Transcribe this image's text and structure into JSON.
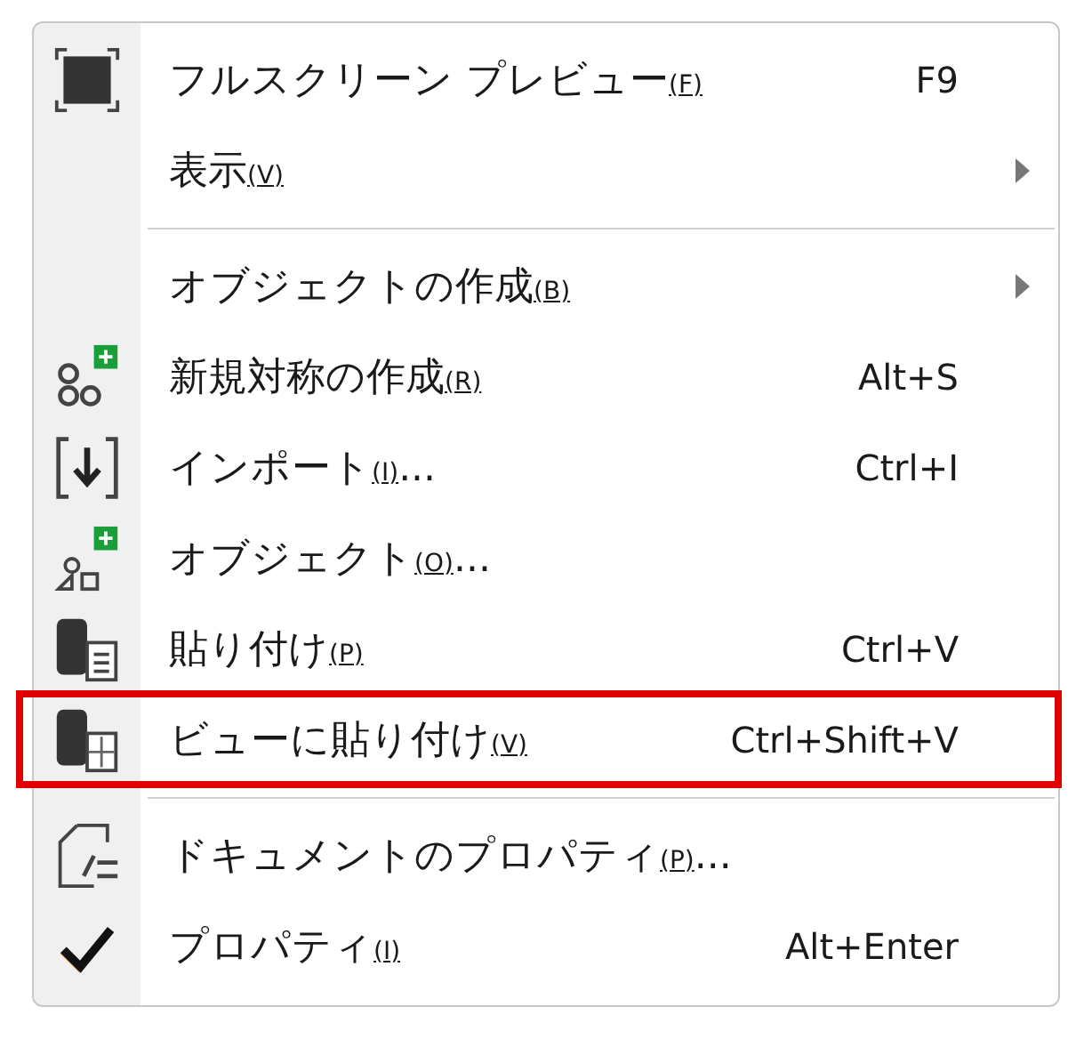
{
  "menu": {
    "items": [
      {
        "kind": "item",
        "label": "フルスクリーン プレビュー",
        "mnemonic": "(F)",
        "shortcut": "F9",
        "submenu": false,
        "highlighted": false,
        "checked": false
      },
      {
        "kind": "item",
        "label": "表示",
        "mnemonic": "(V)",
        "submenu": true,
        "highlighted": false,
        "checked": false
      },
      {
        "kind": "separator"
      },
      {
        "kind": "item",
        "label": "オブジェクトの作成",
        "mnemonic": "(B)",
        "submenu": true,
        "highlighted": false,
        "checked": false
      },
      {
        "kind": "item",
        "label": "新規対称の作成",
        "mnemonic": "(R)",
        "shortcut": "Alt+S",
        "submenu": false,
        "highlighted": false,
        "checked": false
      },
      {
        "kind": "item",
        "label": "インポート",
        "mnemonic": "(I)",
        "ellipsis": "...",
        "shortcut": "Ctrl+I",
        "submenu": false,
        "highlighted": false,
        "checked": false
      },
      {
        "kind": "item",
        "label": "オブジェクト",
        "mnemonic": "(O)",
        "ellipsis": "...",
        "submenu": false,
        "highlighted": false,
        "checked": false
      },
      {
        "kind": "item",
        "label": "貼り付け",
        "mnemonic": "(P)",
        "shortcut": "Ctrl+V",
        "submenu": false,
        "highlighted": false,
        "checked": false
      },
      {
        "kind": "item",
        "label": "ビューに貼り付け",
        "mnemonic": "(V)",
        "shortcut": "Ctrl+Shift+V",
        "submenu": false,
        "highlighted": true,
        "checked": false
      },
      {
        "kind": "separator"
      },
      {
        "kind": "item",
        "label": "ドキュメントのプロパティ",
        "mnemonic": "(P)",
        "ellipsis": "...",
        "submenu": false,
        "highlighted": false,
        "checked": false
      },
      {
        "kind": "item",
        "label": "プロパティ",
        "mnemonic": "(I)",
        "shortcut": "Alt+Enter",
        "submenu": false,
        "highlighted": false,
        "checked": true
      }
    ]
  }
}
